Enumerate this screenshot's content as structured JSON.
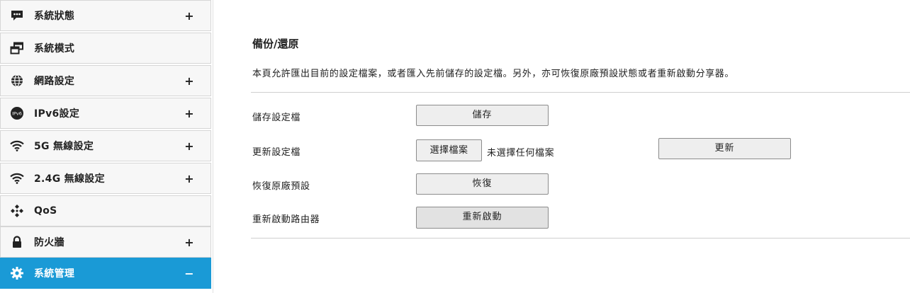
{
  "sidebar": {
    "items": [
      {
        "label": "系統狀態",
        "icon": "chat-bubble-icon",
        "expand": "+"
      },
      {
        "label": "系統模式",
        "icon": "window-mode-icon",
        "expand": ""
      },
      {
        "label": "網路設定",
        "icon": "globe-icon",
        "expand": "+"
      },
      {
        "label": "IPv6設定",
        "icon": "ipv6-icon",
        "expand": "+"
      },
      {
        "label": "5G 無線設定",
        "icon": "wifi-icon",
        "expand": "+"
      },
      {
        "label": "2.4G 無線設定",
        "icon": "wifi-icon",
        "expand": "+"
      },
      {
        "label": "QoS",
        "icon": "qos-diamonds-icon",
        "expand": ""
      },
      {
        "label": "防火牆",
        "icon": "lock-icon",
        "expand": "+"
      },
      {
        "label": "系統管理",
        "icon": "gear-icon",
        "expand": "−"
      }
    ],
    "active_color": "#1a9ad6"
  },
  "main": {
    "title": "備份/還原",
    "description": "本頁允許匯出目前的設定檔案，或者匯入先前儲存的設定檔。另外，亦可恢復原廠預設狀態或者重新啟動分享器。",
    "rows": {
      "save": {
        "label": "儲存設定檔",
        "button": "儲存"
      },
      "update": {
        "label": "更新設定檔",
        "file_button": "選擇檔案",
        "file_status": "未選擇任何檔案",
        "button": "更新"
      },
      "restore": {
        "label": "恢復原廠預設",
        "button": "恢復"
      },
      "reboot": {
        "label": "重新啟動路由器",
        "button": "重新啟動"
      }
    }
  }
}
